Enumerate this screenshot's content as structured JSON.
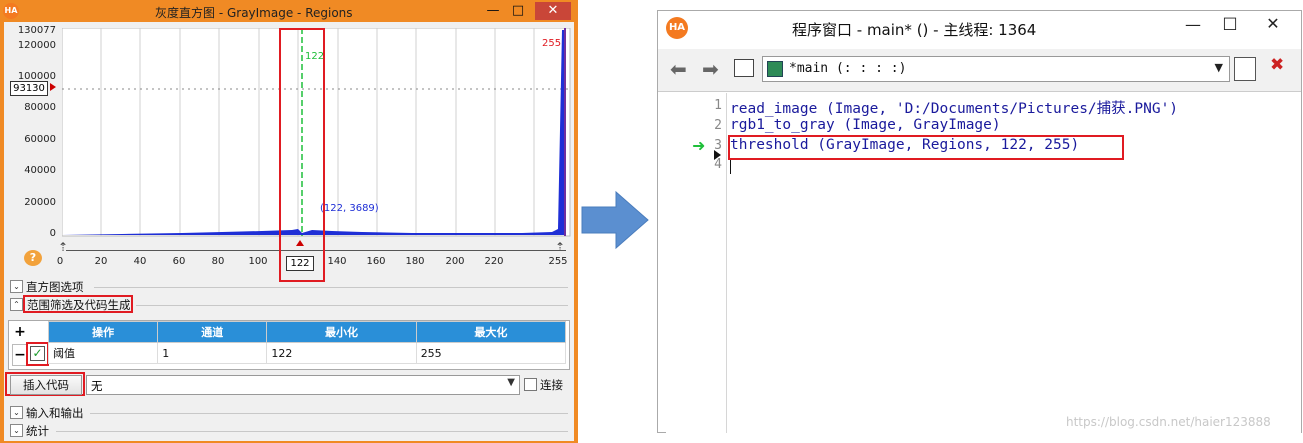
{
  "left_window": {
    "title": "灰度直方图 - GrayImage - Regions",
    "logo": "HA",
    "controls": {
      "minimize": "—",
      "maximize": "□",
      "close": "✕"
    },
    "histogram": {
      "y_labels": [
        "130077",
        "120000",
        "100000",
        "80000",
        "60000",
        "40000",
        "20000",
        "0"
      ],
      "marker_value": "93130",
      "x_labels": [
        "0",
        "20",
        "40",
        "60",
        "80",
        "100",
        "120",
        "140",
        "160",
        "180",
        "200",
        "220",
        "240",
        "255"
      ],
      "selected_x": "122",
      "min_label": "122",
      "max_label": "255",
      "point_annotation": "(122, 3689)",
      "help_icon": "?"
    },
    "sections": {
      "histogram_options": "直方图选项",
      "range_filter": "范围筛选及代码生成",
      "io": "输入和输出",
      "stats": "统计"
    },
    "table": {
      "add": "+",
      "remove": "−",
      "headers": [
        "操作",
        "通道",
        "最小化",
        "最大化"
      ],
      "row": {
        "operation": "阈值",
        "channel": "1",
        "min": "122",
        "max": "255"
      }
    },
    "insert_code_button": "插入代码",
    "dropdown_value": "无",
    "connect_label": "连接"
  },
  "right_window": {
    "title": "程序窗口 - main* () - 主线程: 1364",
    "logo": "HA",
    "procedure_select": "*main (: : : :)",
    "lines": [
      {
        "no": "1",
        "text": "read_image (Image, 'D:/Documents/Pictures/捕获.PNG')"
      },
      {
        "no": "2",
        "text": "rgb1_to_gray (Image, GrayImage)"
      },
      {
        "no": "3",
        "text": "threshold (GrayImage, Regions, 122, 255)"
      },
      {
        "no": "4",
        "text": ""
      }
    ],
    "watermark": "https://blog.csdn.net/haier123888"
  },
  "colors": {
    "left_frame": "#f08a24",
    "highlight": "#e01b22",
    "table_header": "#2a8fd8",
    "code": "#1a1a9c",
    "histogram": "#1f2fd6",
    "arrow": "#5b8fd0"
  }
}
